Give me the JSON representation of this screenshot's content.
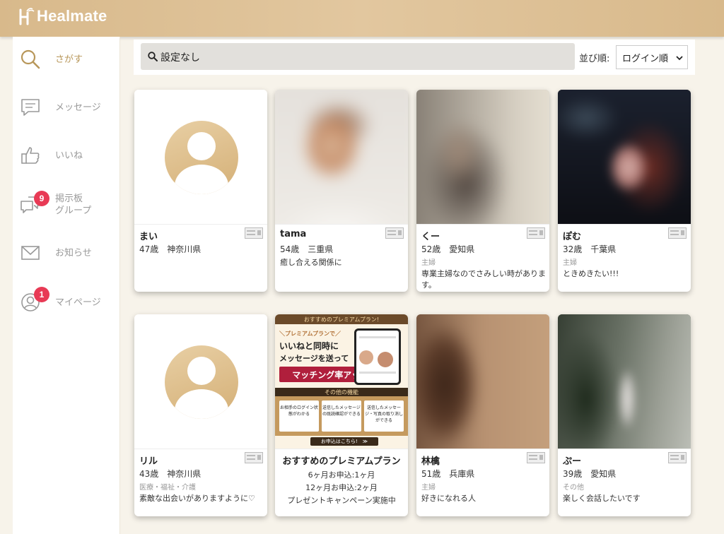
{
  "app": {
    "logo_text": "Healmate",
    "accent": "#d8b98b",
    "active": "#b8975a",
    "badge": "#e83a55"
  },
  "sidebar": {
    "items": [
      {
        "label": "さがす",
        "icon": "search-icon"
      },
      {
        "label": "メッセージ",
        "icon": "message-icon"
      },
      {
        "label": "いいね",
        "icon": "thumbs-up-icon"
      },
      {
        "label": "掲示板\nグループ",
        "icon": "board-icon",
        "badge": "9"
      },
      {
        "label": "お知らせ",
        "icon": "mail-icon"
      },
      {
        "label": "マイページ",
        "icon": "user-icon",
        "badge": "1"
      }
    ]
  },
  "search": {
    "value": "設定なし",
    "sort_label": "並び順:",
    "sort_value": "ログイン順"
  },
  "cards": [
    {
      "name": "まい",
      "meta": "47歳　神奈川県",
      "job": "",
      "msg": "",
      "photo": "avatar"
    },
    {
      "name": "tama",
      "meta": "54歳　三重県",
      "job": "",
      "msg": "癒し合える関係に",
      "photo": "blur1"
    },
    {
      "name": "くー",
      "meta": "52歳　愛知県",
      "job": "主婦",
      "msg": "専業主婦なのでさみしい時がありま\nす。",
      "photo": "blur2"
    },
    {
      "name": "ぽむ",
      "meta": "32歳　千葉県",
      "job": "主婦",
      "msg": "ときめきたい!!!",
      "photo": "blur3"
    },
    {
      "name": "リル",
      "meta": "43歳　神奈川県",
      "job": "医療・福祉・介護",
      "msg": "素敵な出会いがありますように♡",
      "photo": "avatar"
    },
    {
      "name": "林檎",
      "meta": "51歳　兵庫県",
      "job": "主婦",
      "msg": "好きになれる人",
      "photo": "blur4"
    },
    {
      "name": "ぷー",
      "meta": "39歳　愛知県",
      "job": "その他",
      "msg": "楽しく会話したいです",
      "photo": "blur5"
    }
  ],
  "premium": {
    "banner_top": "おすすめのプレミアムプラン!",
    "hero_l1": "＼プレミアムプランで／",
    "hero_l2": "いいねと同時に",
    "hero_l3": "メッセージを送って",
    "hero_btn": "マッチング率アップ!",
    "band": "その他の機能",
    "feat1": "お相手のログイン状態がわかる",
    "feat2": "送信したメッセージの既読確認ができる",
    "feat3": "送信したメッセージ・写真の取り消しができる",
    "apply": "お申込はこちら!　≫",
    "title": "おすすめのプレミアムプラン",
    "line1": "6ヶ月お申込:1ヶ月",
    "line2": "12ヶ月お申込:2ヶ月",
    "line3": "プレゼントキャンペーン実施中"
  }
}
